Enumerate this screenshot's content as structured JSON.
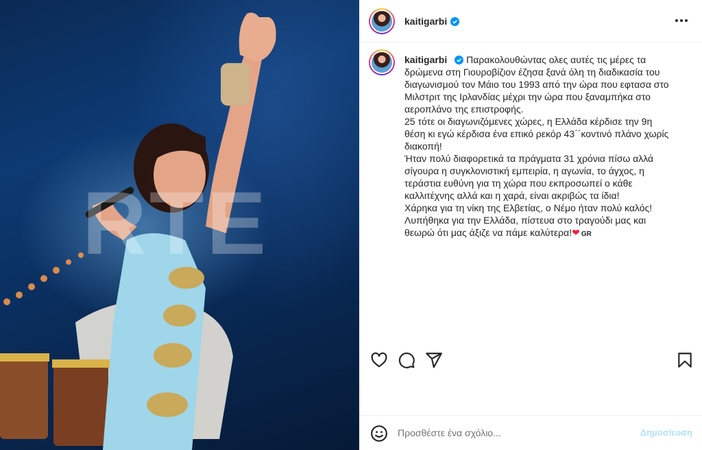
{
  "header": {
    "username": "kaitigarbi"
  },
  "photo": {
    "watermark": "RTE"
  },
  "caption": {
    "username": "kaitigarbi",
    "lines": [
      "Παρακολουθώντας ολες αυτές τις μέρες τα",
      "δρώμενα στη Γιουροβίζιον έζησα ξανά όλη τη διαδικασία του",
      "διαγωνισμού τον Μάιο του 1993 από την ώρα που εφτασα στο",
      "Μιλστριτ της Ιρλανδίας μέχρι την ώρα που ξαναμπήκα στο",
      "αεροπλάνο της επιστροφής.",
      "25 τότε οι διαγωνιζόμενες χώρες, η Ελλάδα κέρδισε την 9η",
      "θέση κι εγώ κέρδισα ένα επικό ρεκόρ 43΄΄κοντινό πλάνο χωρίς",
      "διακοπή!",
      "Ήταν πολύ διαφορετικά τα πράγματα 31 χρόνια πίσω αλλά",
      "σίγουρα η συγκλονιστική εμπειρία, η αγωνία, το άγχος, η",
      "τεράστια ευθύνη για τη χώρα που εκπροσωπεί ο κάθε",
      "καλλιτέχνης αλλά και η χαρά, είναι ακριβώς τα ίδια!",
      "Χάρηκα για τη νίκη της Ελβετίας, ο Νέμο ήταν πολύ καλός!",
      "Λυπήθηκα για την Ελλάδα, πίστευα στο τραγούδι μας και"
    ],
    "last_line": "θεωρώ ότι μας άξιζε να πάμε καλύτερα!",
    "heart": "❤",
    "flag": "GR"
  },
  "actions": {
    "like_icon": "heart-outline-icon",
    "comment_icon": "speech-bubble-icon",
    "share_icon": "paper-plane-icon",
    "save_icon": "bookmark-icon"
  },
  "comment": {
    "placeholder": "Προσθέστε ένα σχόλιο...",
    "post_label": "Δημοσίευση"
  },
  "colors": {
    "verified": "#0095f6",
    "post_disabled": "#b2dffc",
    "heart": "#ed213a"
  }
}
